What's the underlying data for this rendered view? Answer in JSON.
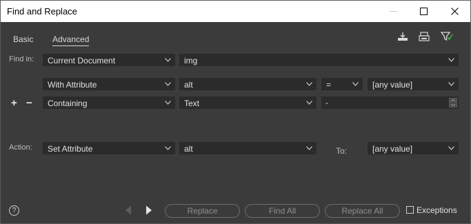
{
  "window": {
    "title": "Find and Replace",
    "controls": [
      "minimize-icon",
      "maximize-icon",
      "close-icon"
    ]
  },
  "tabs": [
    {
      "label": "Basic",
      "active": false
    },
    {
      "label": "Advanced",
      "active": true
    }
  ],
  "toolbar_icons": [
    "save-query-icon",
    "load-query-icon",
    "clear-filter-icon"
  ],
  "find_in": {
    "label": "Find in:",
    "scope": "Current Document",
    "tag": "img"
  },
  "conditions": [
    {
      "type": "With Attribute",
      "attribute": "alt",
      "operator": "=",
      "value": "[any value]"
    },
    {
      "type": "Containing",
      "field": "Text",
      "value": "-"
    }
  ],
  "row_controls": {
    "add": "+",
    "remove": "−"
  },
  "action": {
    "label": "Action:",
    "type": "Set Attribute",
    "attribute": "alt",
    "to_label": "To:",
    "to_value": "[any value]"
  },
  "footer": {
    "help": "?",
    "replace_label": "Replace",
    "find_all_label": "Find All",
    "replace_all_label": "Replace All",
    "exceptions_label": "Exceptions",
    "exceptions_checked": false
  },
  "colors": {
    "background": "#3b3b3b",
    "field": "#2b2b2b",
    "titlebar": "#ffffff",
    "text": "#d8d8d8"
  }
}
